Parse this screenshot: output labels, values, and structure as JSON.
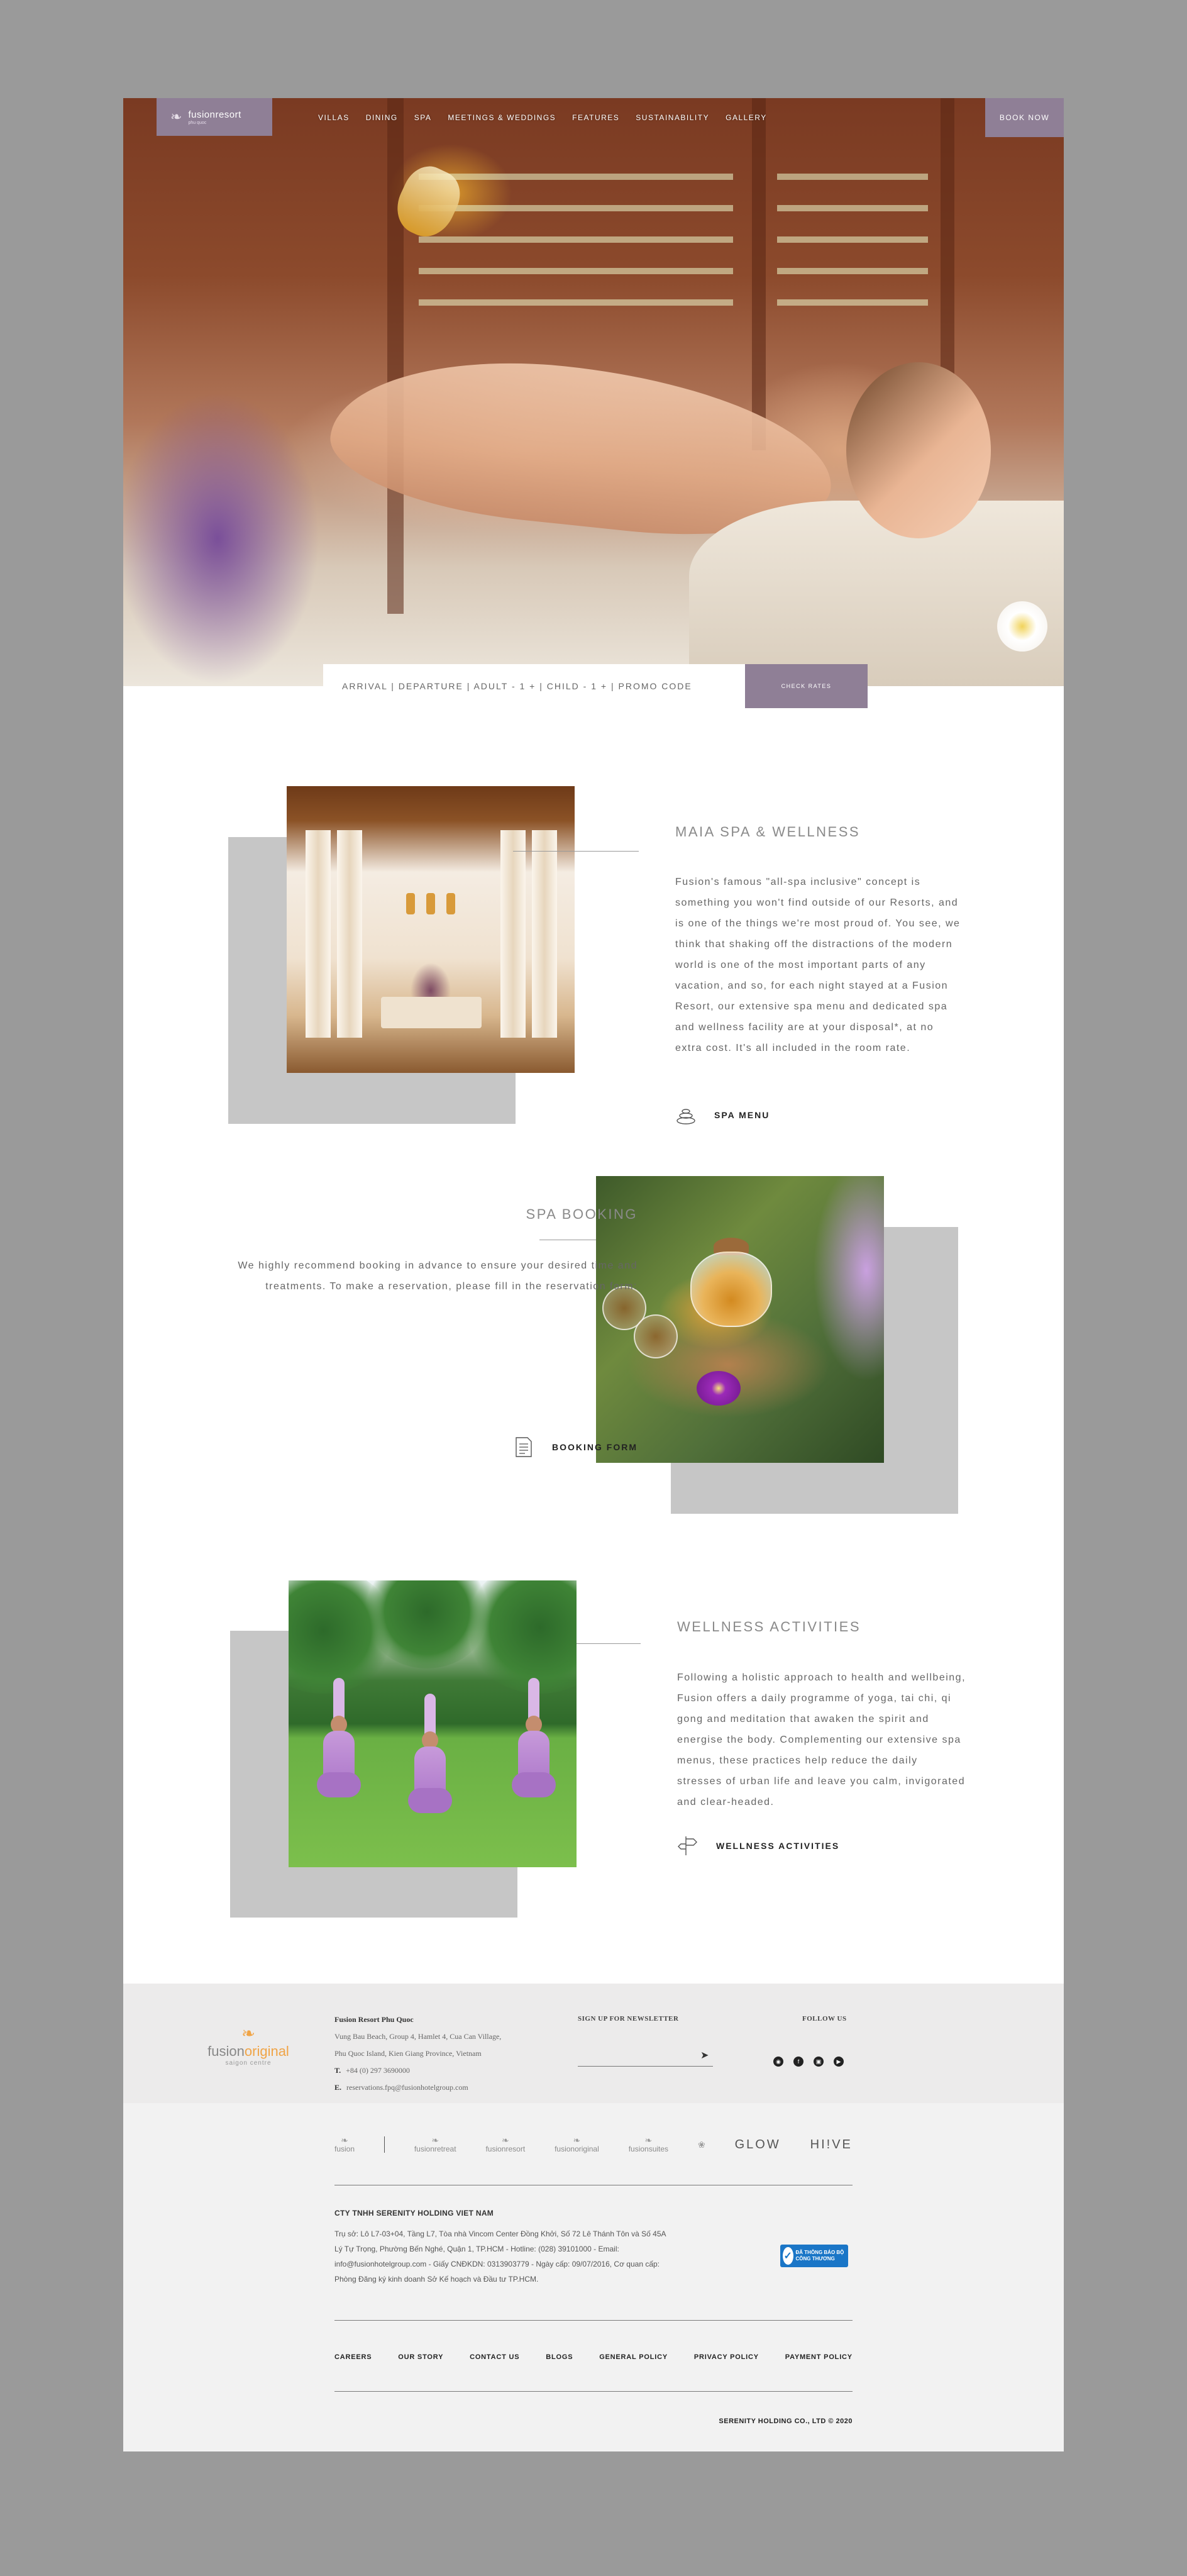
{
  "header": {
    "logo": {
      "text": "fusionresort",
      "sub": "phu quoc"
    },
    "nav": [
      {
        "label": "Villas"
      },
      {
        "label": "Dining"
      },
      {
        "label": "Spa"
      },
      {
        "label": "Meetings & Weddings"
      },
      {
        "label": "Features"
      },
      {
        "label": "Sustainability"
      },
      {
        "label": "Gallery"
      }
    ],
    "book_now": "BOOK NOW"
  },
  "booking_bar": {
    "fields": "ARRIVAL  |  DEPARTURE  |  ADULT - 1 +  |  CHILD - 1 +  |  PROMO CODE",
    "check_rates": "CHECK RATES"
  },
  "sections": {
    "spa": {
      "title": "MAIA SPA & WELLNESS",
      "text": "Fusion's famous \"all-spa inclusive\" concept is something you won't find outside of our Resorts, and is one of the things we're most proud of. You see, we think that shaking off the distractions of the modern world is one of the most important parts of any vacation, and so, for each night stayed at a Fusion Resort, our extensive spa menu and dedicated spa and wellness facility are at your disposal*, at no extra cost. It's all included in the room rate.",
      "link_label": "SPA MENU",
      "icon": "spa-stones-icon"
    },
    "booking": {
      "title": "SPA BOOKING",
      "text": "We highly recommend booking in advance to ensure your desired time and treatments. To make a reservation, please fill in the reservation form:",
      "link_label": "BOOKING FORM",
      "icon": "document-icon"
    },
    "wellness": {
      "title": "WELLNESS ACTIVITIES",
      "text": "Following a holistic approach to health and wellbeing, Fusion offers a daily programme of yoga, tai chi, qi gong and meditation that awaken the spirit and energise the body. Complementing our extensive spa menus, these practices help reduce the daily stresses of urban life and leave you calm, invigorated and clear-headed.",
      "link_label": "WELLNESS ACTIVITIES",
      "icon": "signpost-icon"
    }
  },
  "footer": {
    "logo": {
      "text_a": "fusion",
      "text_b": "original",
      "sub": "saigon centre"
    },
    "resort_name": "Fusion Resort Phu Quoc",
    "address_1": "Vung Bau Beach, Group 4, Hamlet 4, Cua Can Village,",
    "address_2": "Phu Quoc Island, Kien Giang Province, Vietnam",
    "phone_label": "T.",
    "phone": "+84 (0) 297 3690000",
    "email_label": "E.",
    "email": "reservations.fpq@fusionhotelgroup.com",
    "newsletter_title": "SIGN UP FOR NEWSLETTER",
    "newsletter_placeholder": "",
    "follow_title": "FOLLOW US",
    "social": [
      "tripadvisor-icon",
      "facebook-icon",
      "instagram-icon",
      "youtube-icon"
    ],
    "brands": [
      {
        "text": "fusion"
      },
      {
        "text": "fusionretreat"
      },
      {
        "text": "fusionresort"
      },
      {
        "text": "fusionoriginal"
      },
      {
        "text": "fusionsuites"
      },
      {
        "text": ""
      },
      {
        "text": "GLOW"
      },
      {
        "text": "HI!VE"
      }
    ],
    "company_name": "CTY TNHH SERENITY HOLDING VIET NAM",
    "company_info": "Trụ sở: Lô L7-03+04, Tầng L7, Tòa nhà Vincom Center Đồng Khởi, Số 72 Lê Thánh Tôn và Số 45A Lý Tự Trọng, Phường Bến Nghé, Quận 1, TP.HCM - Hotline: (028) 39101000 - Email: info@fusionhotelgroup.com - Giấy CNĐKDN: 0313903779 - Ngày cấp: 09/07/2016, Cơ quan cấp: Phòng Đăng ký kinh doanh Sở Kế hoạch và Đầu tư TP.HCM.",
    "cert_badge": "ĐÃ THÔNG BÁO BỘ CÔNG THƯƠNG",
    "links": [
      "CAREERS",
      "OUR STORY",
      "CONTACT US",
      "BLOGS",
      "GENERAL POLICY",
      "PRIVACY POLICY",
      "PAYMENT POLICY"
    ],
    "copyright": "SERENITY HOLDING CO., LTD © 2020"
  }
}
